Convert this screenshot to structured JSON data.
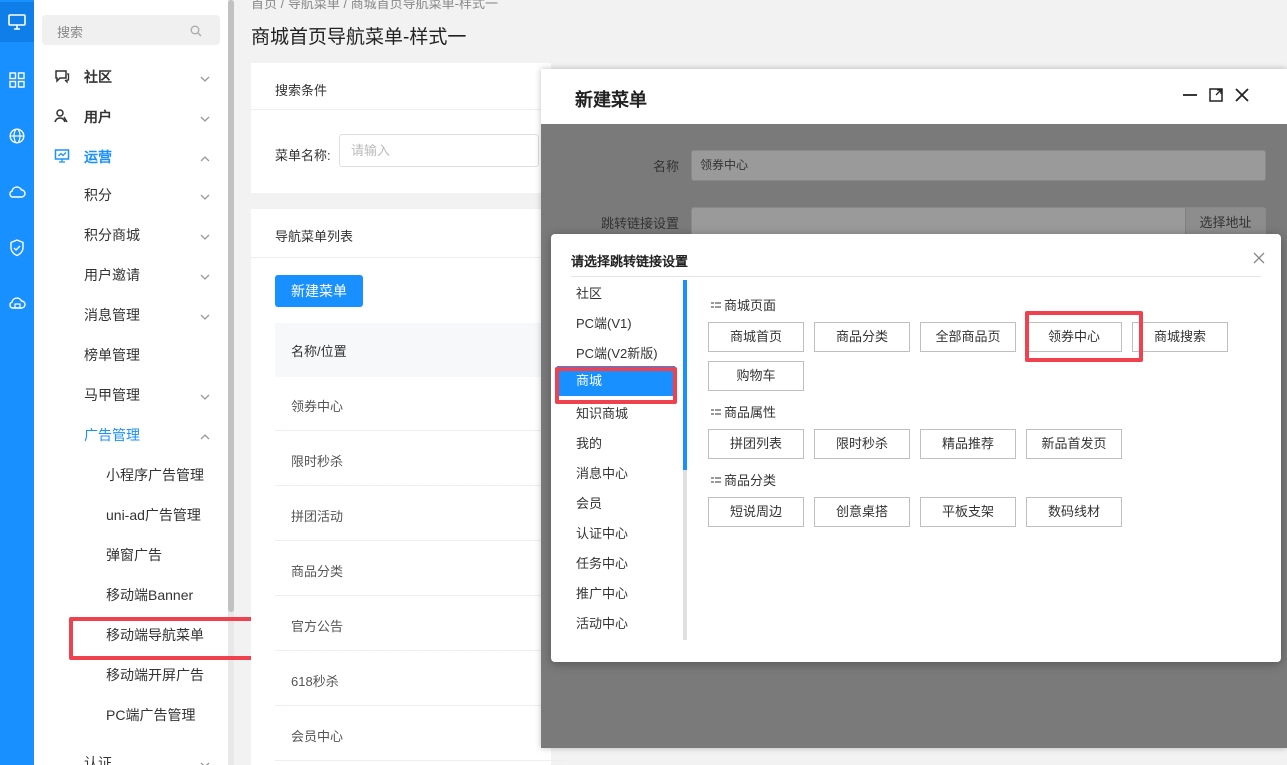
{
  "colors": {
    "primary": "#1890ff",
    "highlight": "#f0414f"
  },
  "rail": {
    "icons": [
      "monitor-icon",
      "grid-icon",
      "globe-icon",
      "cloud-icon",
      "shield-check-icon",
      "cloud-sync-icon"
    ]
  },
  "sidebar": {
    "search_placeholder": "搜索",
    "items": [
      {
        "label": "社区",
        "level": 1,
        "icon": "chat-icon",
        "expanded": false
      },
      {
        "label": "用户",
        "level": 1,
        "icon": "user-icon",
        "expanded": false
      },
      {
        "label": "运营",
        "level": 1,
        "icon": "dashboard-icon",
        "expanded": true,
        "active": true
      },
      {
        "label": "积分",
        "level": 2
      },
      {
        "label": "积分商城",
        "level": 2
      },
      {
        "label": "用户邀请",
        "level": 2
      },
      {
        "label": "消息管理",
        "level": 2
      },
      {
        "label": "榜单管理",
        "level": 2
      },
      {
        "label": "马甲管理",
        "level": 2
      },
      {
        "label": "广告管理",
        "level": 2,
        "active": true,
        "expanded": true
      },
      {
        "label": "小程序广告管理",
        "level": 3
      },
      {
        "label": "uni-ad广告管理",
        "level": 3
      },
      {
        "label": "弹窗广告",
        "level": 3
      },
      {
        "label": "移动端Banner",
        "level": 3
      },
      {
        "label": "移动端导航菜单",
        "level": 3,
        "selected": true
      },
      {
        "label": "移动端开屏广告",
        "level": 3
      },
      {
        "label": "PC端广告管理",
        "level": 3
      },
      {
        "label": "认证",
        "level": 2
      }
    ]
  },
  "main": {
    "breadcrumb": "首页  /  导航菜单  /  商城首页导航菜单-样式一",
    "title": "商城首页导航菜单-样式一",
    "search_card": {
      "title": "搜索条件",
      "field_label": "菜单名称:",
      "placeholder": "请输入"
    },
    "list_card": {
      "title": "导航菜单列表",
      "new_button": "新建菜单",
      "column": "名称/位置",
      "rows": [
        "领券中心",
        "限时秒杀",
        "拼团活动",
        "商品分类",
        "官方公告",
        "618秒杀",
        "会员中心"
      ]
    }
  },
  "modal_new": {
    "title": "新建菜单",
    "name_label": "名称",
    "name_value": "领券中心",
    "link_label": "跳转链接设置",
    "select_address_button": "选择地址"
  },
  "modal_link": {
    "title": "请选择跳转链接设置",
    "categories": [
      "社区",
      "PC端(V1)",
      "PC端(V2新版)",
      "商城",
      "知识商城",
      "我的",
      "消息中心",
      "会员",
      "认证中心",
      "任务中心",
      "推广中心",
      "活动中心"
    ],
    "active_category": "商城",
    "sections": [
      {
        "title": "商城页面",
        "options": [
          "商城首页",
          "商品分类",
          "全部商品页",
          "领券中心",
          "商城搜索",
          "购物车"
        ]
      },
      {
        "title": "商品属性",
        "options": [
          "拼团列表",
          "限时秒杀",
          "精品推荐",
          "新品首发页"
        ]
      },
      {
        "title": "商品分类",
        "options": [
          "短说周边",
          "创意桌搭",
          "平板支架",
          "数码线材"
        ]
      }
    ],
    "selected_option": "领券中心"
  }
}
